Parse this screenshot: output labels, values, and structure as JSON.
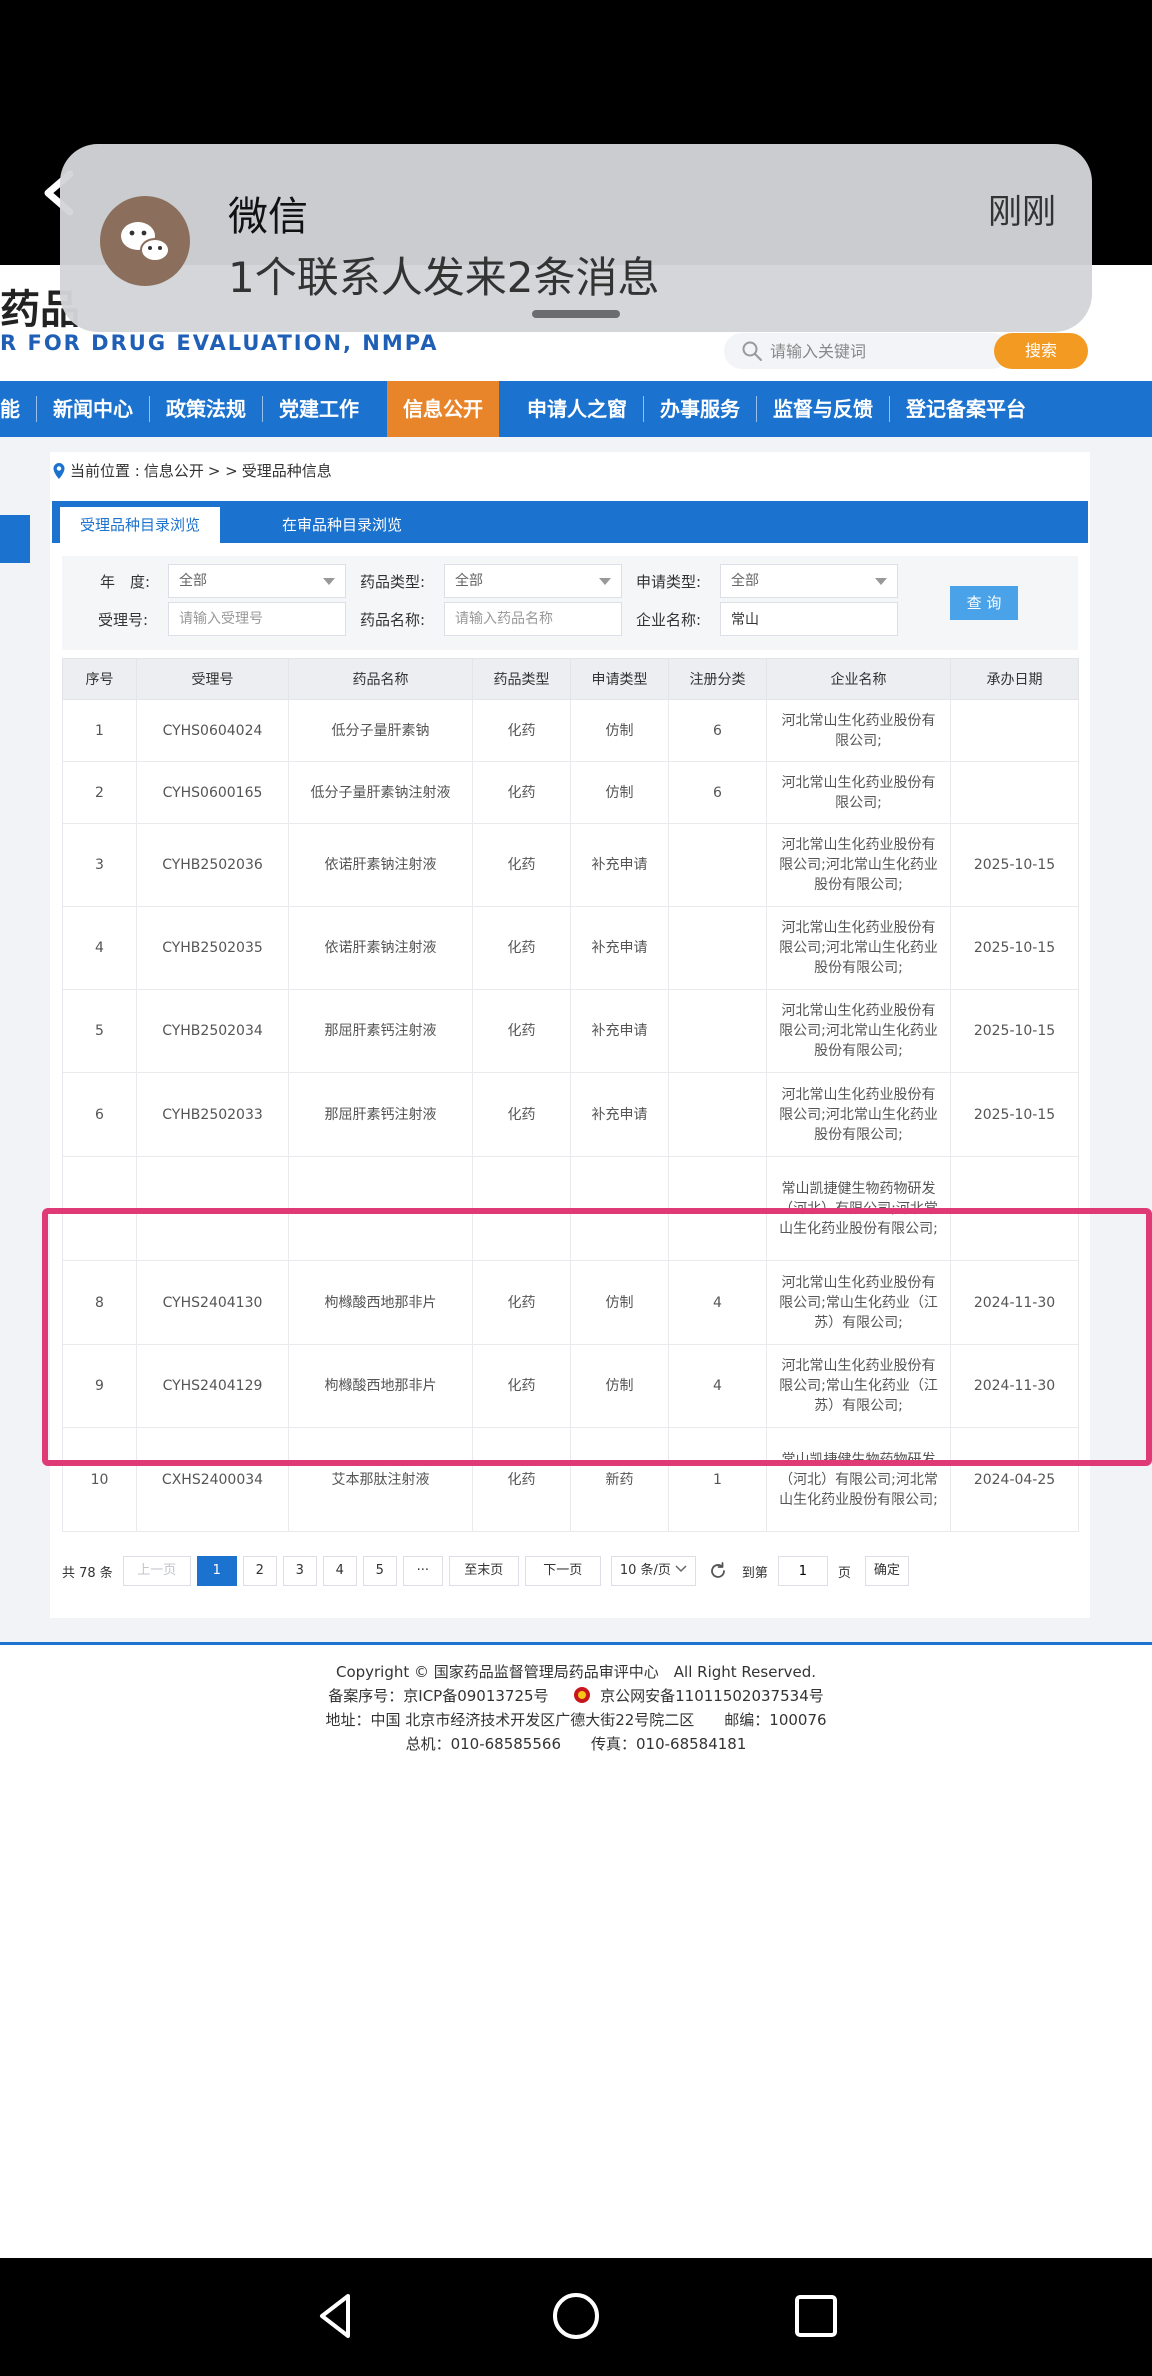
{
  "header": {
    "site_title": "药品",
    "site_subtitle": "R FOR DRUG EVALUATION, NMPA",
    "search_placeholder": "请输入关键词",
    "search_button": "搜索"
  },
  "nav": {
    "items": [
      {
        "label": "能"
      },
      {
        "label": "新闻中心"
      },
      {
        "label": "政策法规"
      },
      {
        "label": "党建工作"
      },
      {
        "label": "信息公开"
      },
      {
        "label": "申请人之窗"
      },
      {
        "label": "办事服务"
      },
      {
        "label": "监督与反馈"
      },
      {
        "label": "登记备案平台"
      }
    ],
    "active": "信息公开"
  },
  "breadcrumb": {
    "prefix": "当前位置 :",
    "path1": "信息公开",
    "sep": "> >",
    "path2": "受理品种信息"
  },
  "tabs": [
    {
      "label": "受理品种目录浏览"
    },
    {
      "label": "在审品种目录浏览"
    }
  ],
  "filters": {
    "year_label": "年　度:",
    "year_value": "全部",
    "drug_type_label": "药品类型:",
    "drug_type_value": "全部",
    "apply_type_label": "申请类型:",
    "apply_type_value": "全部",
    "accept_no_label": "受理号:",
    "accept_no_placeholder": "请输入受理号",
    "drug_name_label": "药品名称:",
    "drug_name_placeholder": "请输入药品名称",
    "company_label": "企业名称:",
    "company_value": "常山",
    "query_button": "查 询"
  },
  "table": {
    "columns": [
      "序号",
      "受理号",
      "药品名称",
      "药品类型",
      "申请类型",
      "注册分类",
      "企业名称",
      "承办日期"
    ],
    "rows": [
      {
        "no": "1",
        "accept": "CYHS0604024",
        "name": "低分子量肝素钠",
        "type": "化药",
        "apply": "仿制",
        "cls": "6",
        "company": "河北常山生化药业股份有限公司;",
        "date": ""
      },
      {
        "no": "2",
        "accept": "CYHS0600165",
        "name": "低分子量肝素钠注射液",
        "type": "化药",
        "apply": "仿制",
        "cls": "6",
        "company": "河北常山生化药业股份有限公司;",
        "date": ""
      },
      {
        "no": "3",
        "accept": "CYHB2502036",
        "name": "依诺肝素钠注射液",
        "type": "化药",
        "apply": "补充申请",
        "cls": "",
        "company": "河北常山生化药业股份有限公司;河北常山生化药业股份有限公司;",
        "date": "2025-10-15"
      },
      {
        "no": "4",
        "accept": "CYHB2502035",
        "name": "依诺肝素钠注射液",
        "type": "化药",
        "apply": "补充申请",
        "cls": "",
        "company": "河北常山生化药业股份有限公司;河北常山生化药业股份有限公司;",
        "date": "2025-10-15"
      },
      {
        "no": "5",
        "accept": "CYHB2502034",
        "name": "那屈肝素钙注射液",
        "type": "化药",
        "apply": "补充申请",
        "cls": "",
        "company": "河北常山生化药业股份有限公司;河北常山生化药业股份有限公司;",
        "date": "2025-10-15"
      },
      {
        "no": "6",
        "accept": "CYHB2502033",
        "name": "那屈肝素钙注射液",
        "type": "化药",
        "apply": "补充申请",
        "cls": "",
        "company": "河北常山生化药业股份有限公司;河北常山生化药业股份有限公司;",
        "date": "2025-10-15"
      },
      {
        "no": "",
        "accept": "",
        "name": "",
        "type": "",
        "apply": "",
        "cls": "",
        "company": "常山凯捷健生物药物研发（河北）有限公司;河北常山生化药业股份有限公司;",
        "date": ""
      },
      {
        "no": "8",
        "accept": "CYHS2404130",
        "name": "枸橼酸西地那非片",
        "type": "化药",
        "apply": "仿制",
        "cls": "4",
        "company": "河北常山生化药业股份有限公司;常山生化药业（江苏）有限公司;",
        "date": "2024-11-30"
      },
      {
        "no": "9",
        "accept": "CYHS2404129",
        "name": "枸橼酸西地那非片",
        "type": "化药",
        "apply": "仿制",
        "cls": "4",
        "company": "河北常山生化药业股份有限公司;常山生化药业（江苏）有限公司;",
        "date": "2024-11-30"
      },
      {
        "no": "10",
        "accept": "CXHS2400034",
        "name": "艾本那肽注射液",
        "type": "化药",
        "apply": "新药",
        "cls": "1",
        "company": "常山凯捷健生物药物研发（河北）有限公司;河北常山生化药业股份有限公司;",
        "date": "2024-04-25"
      }
    ]
  },
  "pager": {
    "total": "共 78 条",
    "prev": "上一页",
    "pages": [
      "1",
      "2",
      "3",
      "4",
      "5"
    ],
    "ellipsis": "···",
    "last": "至末页",
    "next": "下一页",
    "page_size": "10 条/页",
    "goto_label": "到第",
    "goto_value": "1",
    "page_unit": "页",
    "confirm": "确定"
  },
  "footer": {
    "copyright": "Copyright © 国家药品监督管理局药品审评中心　All Right Reserved.",
    "icp": "备案序号：京ICP备09013725号",
    "police": "京公网安备11011502037534号",
    "address": "地址：中国 北京市经济技术开发区广德大街22号院二区　　邮编：100076",
    "phone": "总机：010-68585566　　传真：010-68584181"
  },
  "notification": {
    "app": "微信",
    "time": "刚刚",
    "message": "1个联系人发来2条消息"
  },
  "colors": {
    "nav_blue": "#1c73cf",
    "active_orange": "#e8852a",
    "highlight_pink": "#e03a76"
  }
}
